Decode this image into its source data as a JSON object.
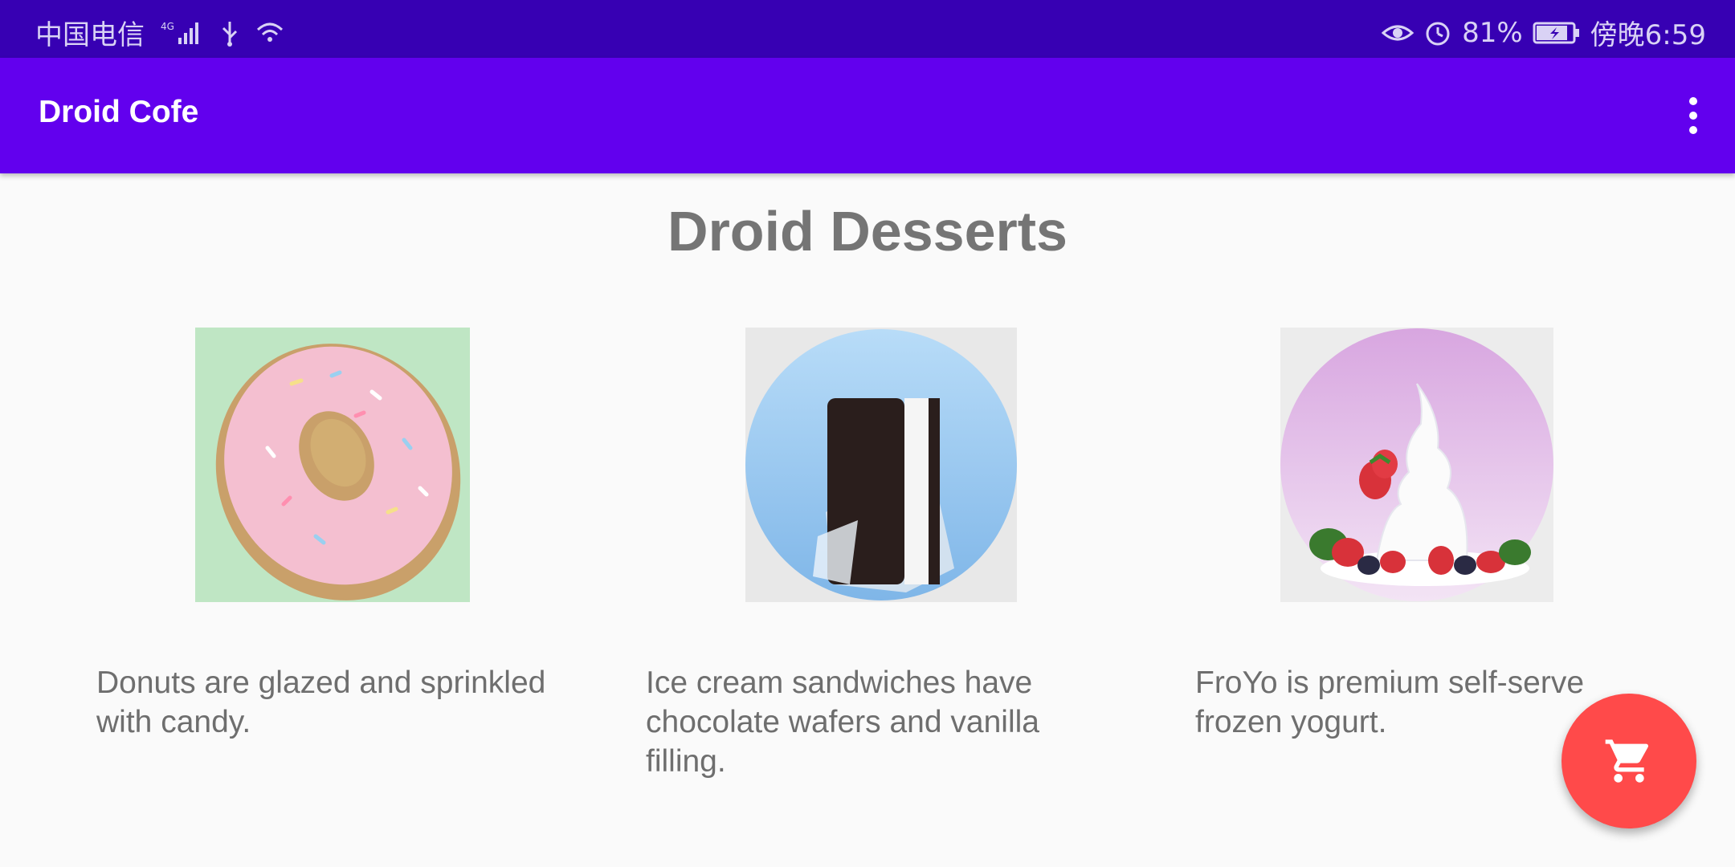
{
  "status_bar": {
    "carrier": "中国电信",
    "network": "4G",
    "battery": "81%",
    "time": "傍晚6:59"
  },
  "app_bar": {
    "title": "Droid Cofe",
    "menu_icon": "more-vert-icon"
  },
  "main": {
    "title": "Droid Desserts",
    "desserts": [
      {
        "name": "donut",
        "description": "Donuts are glazed and sprinkled with candy."
      },
      {
        "name": "ice-cream-sandwich",
        "description": "Ice cream sandwiches have chocolate wafers and vanilla filling."
      },
      {
        "name": "froyo",
        "description": "FroYo is premium self-serve frozen yogurt."
      }
    ]
  },
  "fab": {
    "icon": "shopping-cart-icon",
    "color": "#ff4a4a"
  },
  "colors": {
    "status_bar": "#3700b3",
    "app_bar": "#6200ee",
    "background": "#fafafa"
  }
}
